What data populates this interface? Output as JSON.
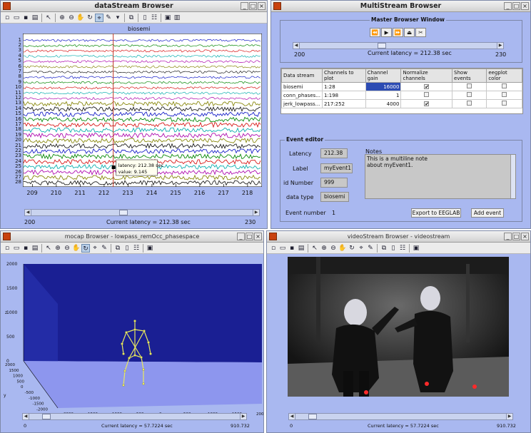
{
  "datastream": {
    "title": "dataStream Browser",
    "axes_title": "biosemi",
    "channels": [
      "1",
      "2",
      "3",
      "4",
      "5",
      "6",
      "7",
      "8",
      "9",
      "10",
      "11",
      "12",
      "13",
      "14",
      "15",
      "16",
      "17",
      "18",
      "19",
      "20",
      "21",
      "22",
      "23",
      "24",
      "25",
      "26",
      "27",
      "28"
    ],
    "trace_colors": [
      "#1a22c8",
      "#0a8a0a",
      "#d81a1a",
      "#10b0b0",
      "#b010b0",
      "#8a8a10",
      "#202020",
      "#1a22c8",
      "#0a8a0a",
      "#d81a1a",
      "#10b0b0",
      "#b010b0",
      "#8a8a10",
      "#202020",
      "#1a22c8",
      "#0a8a0a",
      "#d81a1a",
      "#10b0b0",
      "#b010b0",
      "#8a8a10",
      "#202020",
      "#1a22c8",
      "#0a8a0a",
      "#d81a1a",
      "#10b0b0",
      "#b010b0",
      "#8a8a10",
      "#202020"
    ],
    "x_ticks": [
      "209",
      "210",
      "211",
      "212",
      "213",
      "214",
      "215",
      "216",
      "217",
      "218"
    ],
    "datatip_latency": "latency: 212.38 sec",
    "datatip_value": "value: 9.145",
    "slider_min": "200",
    "slider_max": "230",
    "slider_level": 0.41,
    "current_latency": "Current latency = 212.38 sec"
  },
  "multistream": {
    "title": "MultiStream Browser",
    "panel_title": "Master Browser Window",
    "slider_min": "200",
    "slider_max": "230",
    "slider_level": 0.41,
    "current_latency": "Current latency = 212.38 sec",
    "table_headers": [
      "Data stream",
      "Channels to plot",
      "Channel gain",
      "Normalize channels",
      "Show events",
      "eegplot color"
    ],
    "rows": [
      {
        "stream": "biosemi",
        "channels": "1:28",
        "gain": "16000",
        "normalize": "✔"
      },
      {
        "stream": "conn_phases...",
        "channels": "1:198",
        "gain": "1",
        "normalize": ""
      },
      {
        "stream": "jerk_lowpass...",
        "channels": "217:252",
        "gain": "4000",
        "normalize": "✔"
      }
    ],
    "event_editor": {
      "title": "Event editor",
      "latency_label": "Latency",
      "latency_value": "212.38",
      "label_label": "Label",
      "label_value": "myEvent1",
      "id_label": "id Number",
      "id_value": "999",
      "type_label": "data type",
      "type_value": "biosemi",
      "notes_label": "Notes",
      "notes_text": "This is a multiline note\nabout myEvent1.",
      "event_number_label": "Event number",
      "event_number_value": "1",
      "export_button": "Export to EEGLAB",
      "add_button": "Add event"
    }
  },
  "mocap": {
    "title": "mocap Browser - lowpass_remOcc_phasespace",
    "z_ticks": [
      "2000",
      "1500",
      "1000",
      "500",
      "0"
    ],
    "y_ticks": [
      "2000",
      "1500",
      "1000",
      "500",
      "0",
      "-500",
      "-1000",
      "-1500",
      "-2000"
    ],
    "x_ticks": [
      "-2000",
      "-1500",
      "-1000",
      "-500",
      "0",
      "500",
      "1000",
      "1500",
      "2000"
    ],
    "z_label": "z",
    "y_label": "y",
    "x_label": "x",
    "slider_min": "0",
    "slider_max": "910.732",
    "slider_level": 0.06,
    "current_latency": "Current latency = 57.7224 sec"
  },
  "video": {
    "title": "videoStream Browser - videostream",
    "slider_min": "0",
    "slider_max": "910.732",
    "slider_level": 0.06,
    "current_latency": "Current latency = 57.7224 sec"
  }
}
